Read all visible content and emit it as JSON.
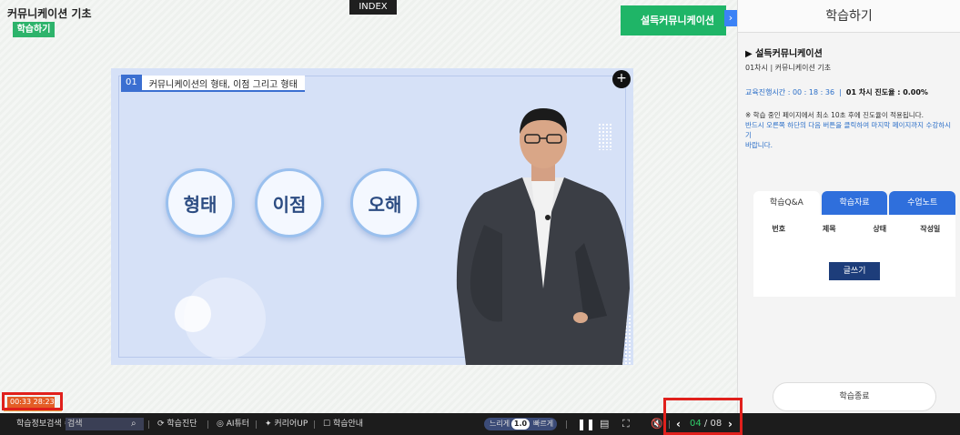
{
  "course": {
    "title": "커뮤니케이션 기초",
    "badge": "학습하기"
  },
  "index_tab": "INDEX",
  "banner": {
    "label": "설득커뮤니케이션"
  },
  "slide": {
    "number": "01",
    "title": "커뮤니케이션의 형태, 이점 그리고 형태",
    "bubbles": [
      "형태",
      "이점",
      "오해"
    ]
  },
  "timer": "00:33  28:23",
  "toolbar": {
    "search_label": "학습정보검색",
    "search_placeholder": "검색",
    "diagnose": "학습진단",
    "ai_tutor": "AI튜터",
    "career_up": "커리어UP",
    "guide": "학습안내",
    "slow": "느리게",
    "speed": "1.0",
    "fast": "빠르게",
    "page_current": "04",
    "page_total": "/ 08"
  },
  "sidebar": {
    "header": "학습하기",
    "course_name": "설득커뮤니케이션",
    "session": "01차시 | 커뮤니케이션 기초",
    "time_label": "교육진행시간 : 00 : 18 : 36",
    "progress_label": "01 차시 진도율 : 0.00%",
    "note_1": "※ 학습 중인 페이지에서 최소 10초 후에 진도율이 적용됩니다.",
    "note_2": "반드시 오른쪽 하단의 다음 버튼을 클릭하여 마지막 페이지까지 수강하시기",
    "note_3": "바랍니다.",
    "tabs": [
      "학습Q&A",
      "학습자료",
      "수업노트"
    ],
    "columns": [
      "번호",
      "제목",
      "상태",
      "작성일"
    ],
    "write_button": "글쓰기",
    "end_button": "학습종료"
  },
  "colors": {
    "green": "#1fb567",
    "blue": "#2f6fdc",
    "navy": "#1d3d7a",
    "red": "#e0201c"
  }
}
